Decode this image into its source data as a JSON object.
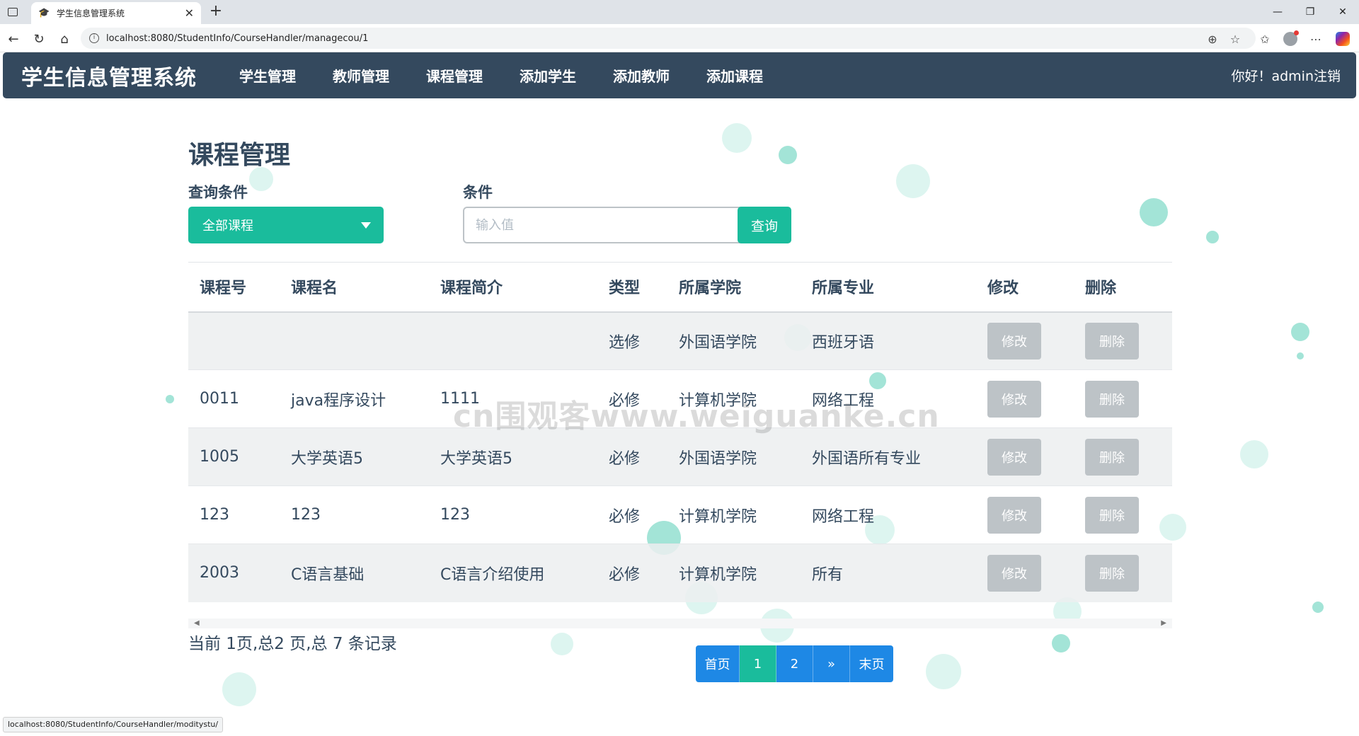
{
  "browser": {
    "tab_title": "学生信息管理系统",
    "tab_favicon": "student-cap-icon",
    "url": "localhost:8080/StudentInfo/CourseHandler/managecou/1",
    "status_url": "localhost:8080/StudentInfo/CourseHandler/moditystu/"
  },
  "navbar": {
    "brand": "学生信息管理系统",
    "items": [
      {
        "label": "学生管理"
      },
      {
        "label": "教师管理"
      },
      {
        "label": "课程管理"
      },
      {
        "label": "添加学生"
      },
      {
        "label": "添加教师"
      },
      {
        "label": "添加课程"
      }
    ],
    "greeting": "你好！admin注销"
  },
  "page": {
    "title": "课程管理",
    "query_label": "查询条件",
    "select_value": "全部课程",
    "condition_label": "条件",
    "input_placeholder": "输入值",
    "query_button": "查询"
  },
  "table": {
    "headers": [
      "课程号",
      "课程名",
      "课程简介",
      "类型",
      "所属学院",
      "所属专业",
      "修改",
      "删除"
    ],
    "edit_label": "修改",
    "delete_label": "删除",
    "rows": [
      {
        "id": "",
        "name": "",
        "intro": "",
        "type": "选修",
        "college": "外国语学院",
        "major": "西班牙语"
      },
      {
        "id": "0011",
        "name": "java程序设计",
        "intro": "1111",
        "type": "必修",
        "college": "计算机学院",
        "major": "网络工程"
      },
      {
        "id": "1005",
        "name": "大学英语5",
        "intro": "大学英语5",
        "type": "必修",
        "college": "外国语学院",
        "major": "外国语所有专业"
      },
      {
        "id": "123",
        "name": "123",
        "intro": "123",
        "type": "必修",
        "college": "计算机学院",
        "major": "网络工程"
      },
      {
        "id": "2003",
        "name": "C语言基础",
        "intro": "C语言介绍使用",
        "type": "必修",
        "college": "计算机学院",
        "major": "所有"
      }
    ]
  },
  "summary": "当前 1页,总2 页,总 7 条记录",
  "pagination": {
    "first": "首页",
    "pages": [
      "1",
      "2"
    ],
    "active_page": "1",
    "next": "»",
    "last": "末页"
  },
  "watermark": "cn围观客www.weiguanke.cn",
  "colors": {
    "navbar": "#34495e",
    "accent": "#1abc9c",
    "pager": "#1e88e5",
    "disabled_button": "#bdc3c7"
  }
}
